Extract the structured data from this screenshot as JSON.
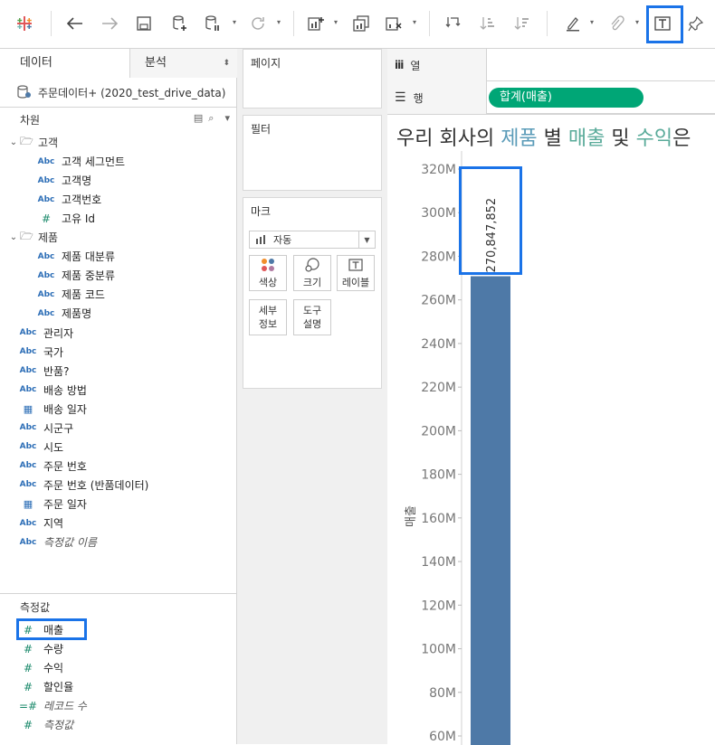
{
  "colors": {
    "bar": "#4e79a7",
    "pill": "#00a676",
    "highlight": "#1a73e8",
    "title_accent": "#5a9bb8"
  },
  "toolbar": {
    "icons": [
      "tableau-logo-icon",
      "undo-icon",
      "redo-icon",
      "save-icon",
      "new-datasource-icon",
      "pause-update-icon",
      "refresh-icon",
      "new-worksheet-icon",
      "duplicate-sheet-icon",
      "clear-sheet-icon",
      "swap-icon",
      "sort-asc-icon",
      "sort-desc-icon",
      "highlight-icon",
      "group-icon",
      "show-labels-icon",
      "pin-icon"
    ]
  },
  "datapane": {
    "tab_data": "데이터",
    "tab_analysis": "분석",
    "datasource_name": "주문데이터+ (2020_test_drive_data)",
    "dimensions_header": "차원",
    "measures_header": "측정값",
    "dimensions": [
      {
        "type": "folder",
        "label": "고객"
      },
      {
        "type": "abc",
        "label": "고객 세그먼트",
        "indent": 1
      },
      {
        "type": "abc",
        "label": "고객명",
        "indent": 1
      },
      {
        "type": "abc",
        "label": "고객번호",
        "indent": 1
      },
      {
        "type": "num",
        "label": "고유 Id",
        "indent": 1
      },
      {
        "type": "folder",
        "label": "제품"
      },
      {
        "type": "abc",
        "label": "제품 대분류",
        "indent": 1
      },
      {
        "type": "abc",
        "label": "제품 중분류",
        "indent": 1
      },
      {
        "type": "abc",
        "label": "제품 코드",
        "indent": 1
      },
      {
        "type": "abc",
        "label": "제품명",
        "indent": 1
      },
      {
        "type": "abc",
        "label": "관리자",
        "indent": 0
      },
      {
        "type": "abc",
        "label": "국가",
        "indent": 0
      },
      {
        "type": "abc",
        "label": "반품?",
        "indent": 0
      },
      {
        "type": "abc",
        "label": "배송 방법",
        "indent": 0
      },
      {
        "type": "date",
        "label": "배송 일자",
        "indent": 0
      },
      {
        "type": "abc",
        "label": "시군구",
        "indent": 0
      },
      {
        "type": "abc",
        "label": "시도",
        "indent": 0
      },
      {
        "type": "abc",
        "label": "주문 번호",
        "indent": 0
      },
      {
        "type": "abc",
        "label": "주문 번호 (반품데이터)",
        "indent": 0
      },
      {
        "type": "date",
        "label": "주문 일자",
        "indent": 0
      },
      {
        "type": "abc",
        "label": "지역",
        "indent": 0
      },
      {
        "type": "abc",
        "label": "측정값 이름",
        "indent": 0,
        "italic": true
      }
    ],
    "measures": [
      {
        "type": "num",
        "label": "매출"
      },
      {
        "type": "num",
        "label": "수량"
      },
      {
        "type": "num",
        "label": "수익"
      },
      {
        "type": "num",
        "label": "할인율"
      },
      {
        "type": "calc",
        "label": "레코드 수",
        "italic": true
      },
      {
        "type": "num",
        "label": "측정값",
        "italic": true
      }
    ],
    "abc_label": "Abc",
    "num_label": "#",
    "date_label": "▦"
  },
  "shelves": {
    "pages": "페이지",
    "filters": "필터",
    "marks": "마크",
    "mark_type": "자동",
    "mark_buttons": [
      "색상",
      "크기",
      "레이블",
      "세부\n정보",
      "도구\n설명"
    ],
    "columns_label": "열",
    "rows_label": "행",
    "rows_pill": "합계(매출)"
  },
  "view": {
    "title_parts": [
      "우리 회사의 ",
      "제품",
      " 별 ",
      "매출",
      " 및 ",
      "수익",
      "은"
    ]
  },
  "chart_data": {
    "type": "bar",
    "categories": [
      ""
    ],
    "values": [
      270847852
    ],
    "data_labels": [
      "270,847,852"
    ],
    "title": "우리 회사의 제품 별 매출 및 수익은",
    "xlabel": "",
    "ylabel": "매출",
    "ylim": [
      60000000,
      320000000
    ],
    "yticks": [
      "320M",
      "300M",
      "280M",
      "260M",
      "240M",
      "220M",
      "200M",
      "180M",
      "160M",
      "140M",
      "120M",
      "100M",
      "80M",
      "60M"
    ],
    "grid": false
  }
}
